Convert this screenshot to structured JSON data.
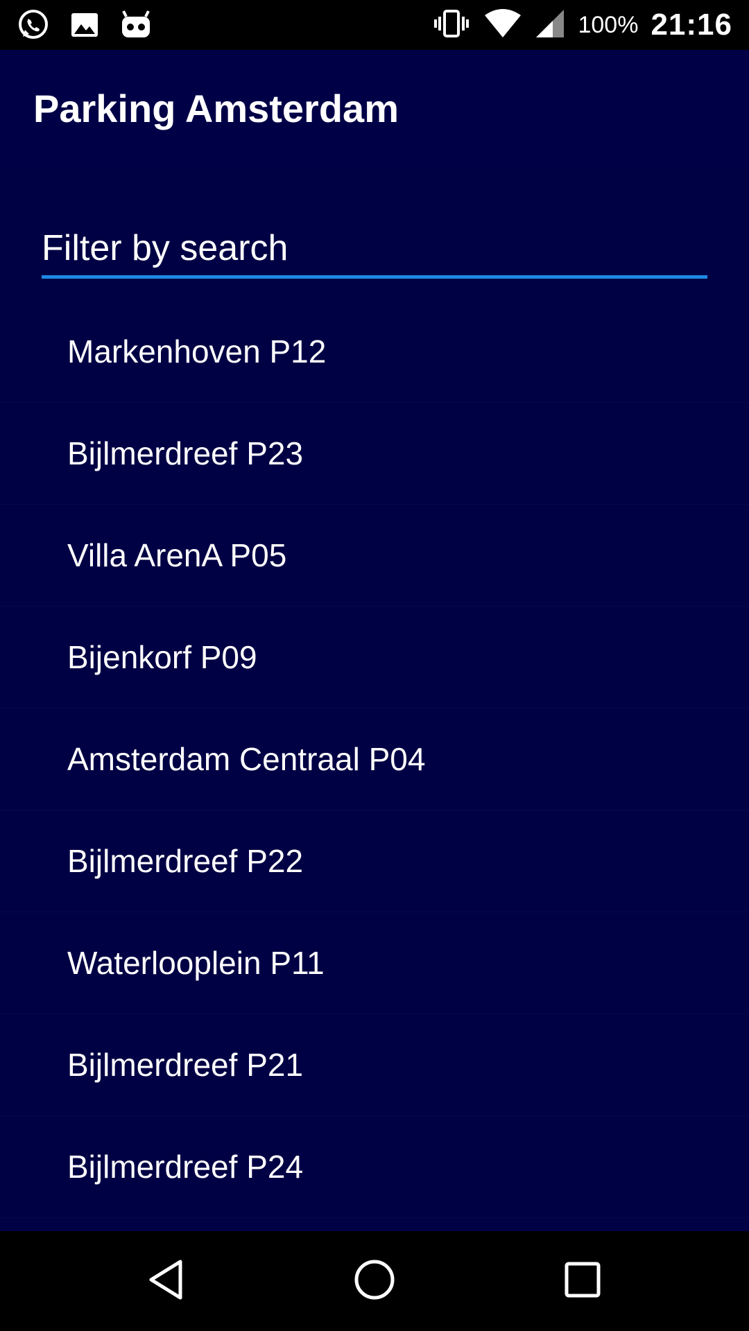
{
  "status_bar": {
    "battery": "100%",
    "time": "21:16",
    "left_icons": [
      "whatsapp-icon",
      "image-icon",
      "robot-icon"
    ],
    "right_icons": [
      "vibrate-icon",
      "wifi-icon",
      "signal-icon"
    ]
  },
  "app_bar": {
    "title": "Parking Amsterdam"
  },
  "search": {
    "placeholder": "Filter by search",
    "value": ""
  },
  "list": {
    "items": [
      {
        "label": "Markenhoven P12"
      },
      {
        "label": "Bijlmerdreef P23"
      },
      {
        "label": "Villa ArenA P05"
      },
      {
        "label": "Bijenkorf P09"
      },
      {
        "label": "Amsterdam Centraal P04"
      },
      {
        "label": "Bijlmerdreef P22"
      },
      {
        "label": "Waterlooplein P11"
      },
      {
        "label": "Bijlmerdreef P21"
      },
      {
        "label": "Bijlmerdreef P24"
      }
    ]
  },
  "nav_bar": {
    "buttons": [
      "back-icon",
      "home-icon",
      "recents-icon"
    ]
  },
  "colors": {
    "background": "#000044",
    "app_bar": "#000047",
    "accent": "#1e88e5",
    "text": "#ffffff"
  }
}
